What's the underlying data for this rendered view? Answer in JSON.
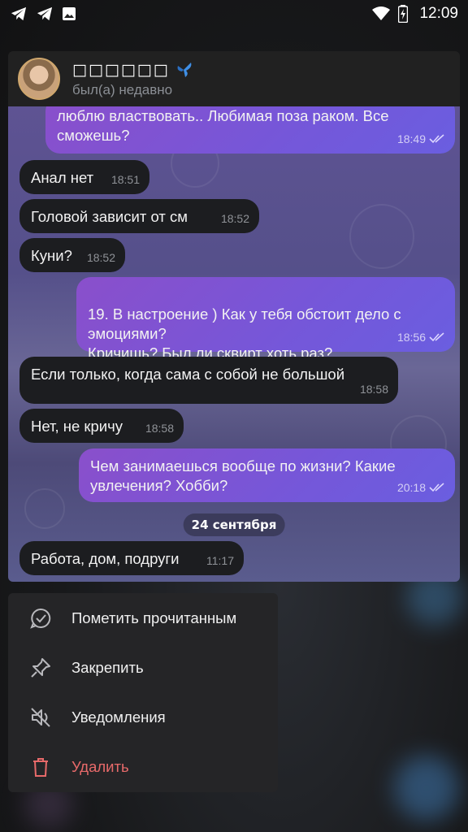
{
  "status_bar": {
    "time": "12:09",
    "left_icons": [
      "telegram-icon",
      "telegram-icon",
      "gallery-icon"
    ],
    "right_icons": [
      "wifi-icon",
      "battery-charging-icon"
    ]
  },
  "header": {
    "name": "□□□□□□",
    "name_emoji": "butterfly-icon",
    "status": "был(а) недавно"
  },
  "messages": [
    {
      "dir": "out",
      "text": "люблю властвовать.. Любимая поза раком. Все сможешь?",
      "time": "18:49",
      "read": true
    },
    {
      "dir": "in",
      "text": "Анал нет",
      "time": "18:51"
    },
    {
      "dir": "in",
      "text": "Головой зависит от см",
      "time": "18:52"
    },
    {
      "dir": "in",
      "text": "Куни?",
      "time": "18:52"
    },
    {
      "dir": "out",
      "text": "19. В настроение ) Как у тебя обстоит дело с эмоциями?\nКричишь? Был ли сквирт хоть раз?",
      "time": "18:56",
      "read": true
    },
    {
      "dir": "in",
      "text": "Если только, когда сама с собой не большой",
      "time": "18:58"
    },
    {
      "dir": "in",
      "text": "Нет, не кричу",
      "time": "18:58"
    },
    {
      "dir": "out",
      "text": "Чем занимаешься вообще по жизни? Какие увлечения? Хобби?",
      "time": "20:18",
      "read": true
    },
    {
      "dir": "in",
      "text": "Работа, дом, подруги",
      "time": "11:17"
    }
  ],
  "date_separator": "24 сентября",
  "menu": {
    "items": [
      {
        "label": "Пометить прочитанным",
        "icon": "check-circle-icon"
      },
      {
        "label": "Закрепить",
        "icon": "pin-icon"
      },
      {
        "label": "Уведомления",
        "icon": "bell-off-icon"
      },
      {
        "label": "Удалить",
        "icon": "trash-icon"
      }
    ]
  },
  "colors": {
    "outgoing_bubble": "#7a55d6",
    "incoming_bubble": "#1c1d20",
    "danger": "#e86a6a",
    "menu_bg": "#252527"
  }
}
